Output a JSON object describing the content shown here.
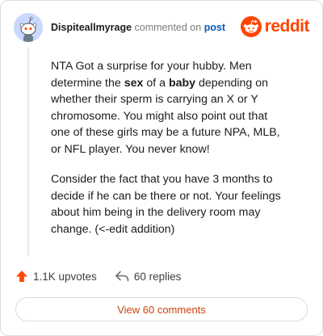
{
  "comment": {
    "username": "Dispiteallmyrage",
    "commented_text": "commented on",
    "post_link": "post",
    "paragraphs": [
      {
        "parts": [
          "NTA Got a surprise for your hubby. Men determine the ",
          "sex",
          " of a ",
          "baby",
          " depending on whether their sperm is carrying an X or Y chromosome. You might also point out that one of these girls may be a future NPA, MLB, or NFL player. You never know!"
        ]
      },
      {
        "text": "Consider the fact that you have 3 months to decide if he can be there or not. Your feelings about him being in the delivery room may change. (<-edit addition)"
      }
    ]
  },
  "brand": {
    "name": "reddit",
    "color": "#ff4500"
  },
  "footer": {
    "upvotes": "1.1K upvotes",
    "replies": "60 replies",
    "view_button": "View 60 comments"
  },
  "icons": {
    "avatar": "snoo-avatar",
    "brand": "reddit-logo-icon",
    "upvote": "upvote-arrow-icon",
    "reply": "reply-arrow-icon"
  }
}
